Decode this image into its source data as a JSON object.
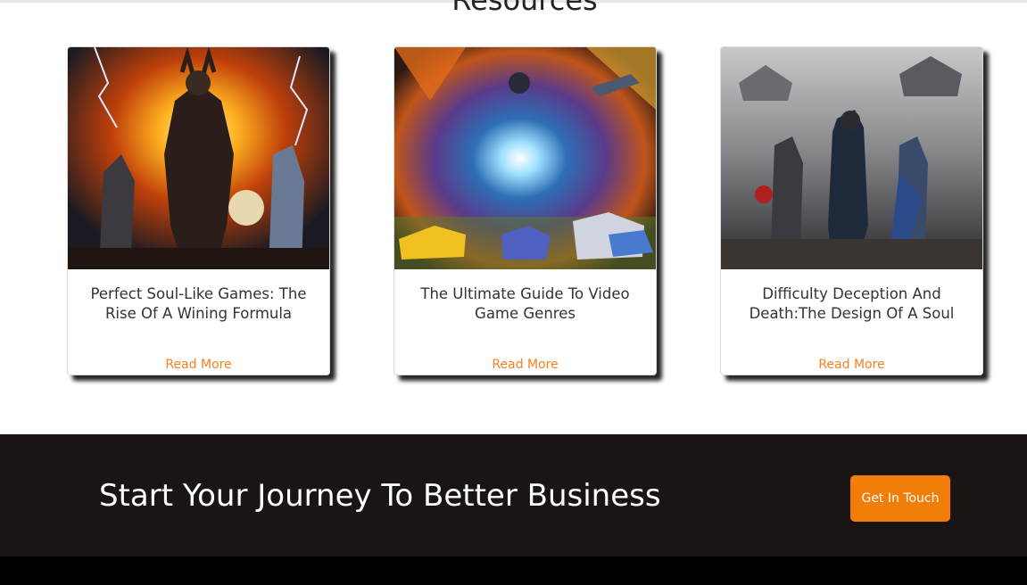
{
  "section": {
    "title": "Resources"
  },
  "cards": [
    {
      "title": "Perfect Soul-Like Games: The Rise Of A Wining Formula",
      "read_more": "Read More"
    },
    {
      "title": "The Ultimate Guide To Video Game Genres",
      "read_more": "Read More"
    },
    {
      "title": "Difficulty Deception And Death:The Design Of A Soul",
      "read_more": "Read More"
    }
  ],
  "cta": {
    "heading": "Start Your Journey To Better Business",
    "button_label": "Get In Touch"
  },
  "colors": {
    "accent": "#f27d08",
    "read_more": "#f58220",
    "cta_background": "#1b1414",
    "footer": "#000000"
  }
}
